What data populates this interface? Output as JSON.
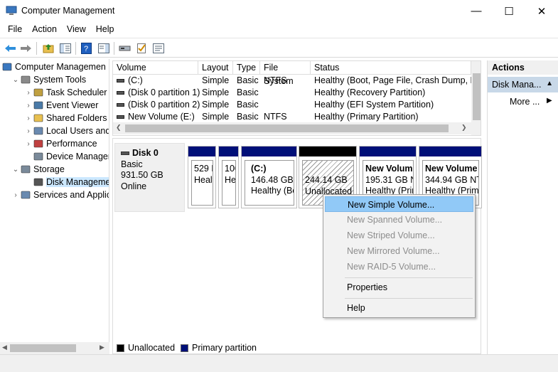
{
  "window": {
    "title": "Computer Management"
  },
  "menu": [
    "File",
    "Action",
    "View",
    "Help"
  ],
  "tree": [
    {
      "label": "Computer Managemen",
      "indent": 0,
      "exp": "",
      "icon": "computer-icon"
    },
    {
      "label": "System Tools",
      "indent": 1,
      "exp": "⌄",
      "icon": "tools-icon"
    },
    {
      "label": "Task Scheduler",
      "indent": 2,
      "exp": "›",
      "icon": "clock-icon"
    },
    {
      "label": "Event Viewer",
      "indent": 2,
      "exp": "›",
      "icon": "event-icon"
    },
    {
      "label": "Shared Folders",
      "indent": 2,
      "exp": "›",
      "icon": "folder-icon"
    },
    {
      "label": "Local Users and",
      "indent": 2,
      "exp": "›",
      "icon": "users-icon"
    },
    {
      "label": "Performance",
      "indent": 2,
      "exp": "›",
      "icon": "performance-icon"
    },
    {
      "label": "Device Manager",
      "indent": 2,
      "exp": "",
      "icon": "device-icon"
    },
    {
      "label": "Storage",
      "indent": 1,
      "exp": "⌄",
      "icon": "storage-icon"
    },
    {
      "label": "Disk Manageme",
      "indent": 2,
      "exp": "",
      "icon": "disk-icon",
      "selected": true
    },
    {
      "label": "Services and Applica",
      "indent": 1,
      "exp": "›",
      "icon": "services-icon"
    }
  ],
  "volumes": {
    "headers": [
      "Volume",
      "Layout",
      "Type",
      "File System",
      "Status"
    ],
    "rows": [
      [
        "(C:)",
        "Simple",
        "Basic",
        "NTFS",
        "Healthy (Boot, Page File, Crash Dump, Pri"
      ],
      [
        "(Disk 0 partition 1)",
        "Simple",
        "Basic",
        "",
        "Healthy (Recovery Partition)"
      ],
      [
        "(Disk 0 partition 2)",
        "Simple",
        "Basic",
        "",
        "Healthy (EFI System Partition)"
      ],
      [
        "New Volume (E:)",
        "Simple",
        "Basic",
        "NTFS",
        "Healthy (Primary Partition)"
      ]
    ]
  },
  "disk": {
    "name": "Disk 0",
    "type": "Basic",
    "size": "931.50 GB",
    "state": "Online",
    "partitions": [
      {
        "title": "",
        "line1": "529 M",
        "line2": "Healt"
      },
      {
        "title": "",
        "line1": "100",
        "line2": "He"
      },
      {
        "title": "(C:)",
        "line1": "146.48 GB NT",
        "line2": "Healthy (Boc"
      },
      {
        "title": "",
        "line1": "244.14 GB",
        "line2": "Unallocated"
      },
      {
        "title": "New Volume",
        "line1": "195.31 GB NTF",
        "line2": "Healthy (Prim"
      },
      {
        "title": "New Volume",
        "line1": "344.94 GB NTF",
        "line2": "Healthy (Prim"
      }
    ]
  },
  "legend": {
    "unallocated": "Unallocated",
    "primary": "Primary partition"
  },
  "actions": {
    "header": "Actions",
    "sub": "Disk Mana...",
    "more": "More ..."
  },
  "context_menu": {
    "new_simple": "New Simple Volume...",
    "new_spanned": "New Spanned Volume...",
    "new_striped": "New Striped Volume...",
    "new_mirrored": "New Mirrored Volume...",
    "new_raid5": "New RAID-5 Volume...",
    "properties": "Properties",
    "help": "Help"
  },
  "colors": {
    "primary_partition": "#000f78",
    "unallocated": "#000000",
    "menu_highlight": "#91c9f7"
  }
}
